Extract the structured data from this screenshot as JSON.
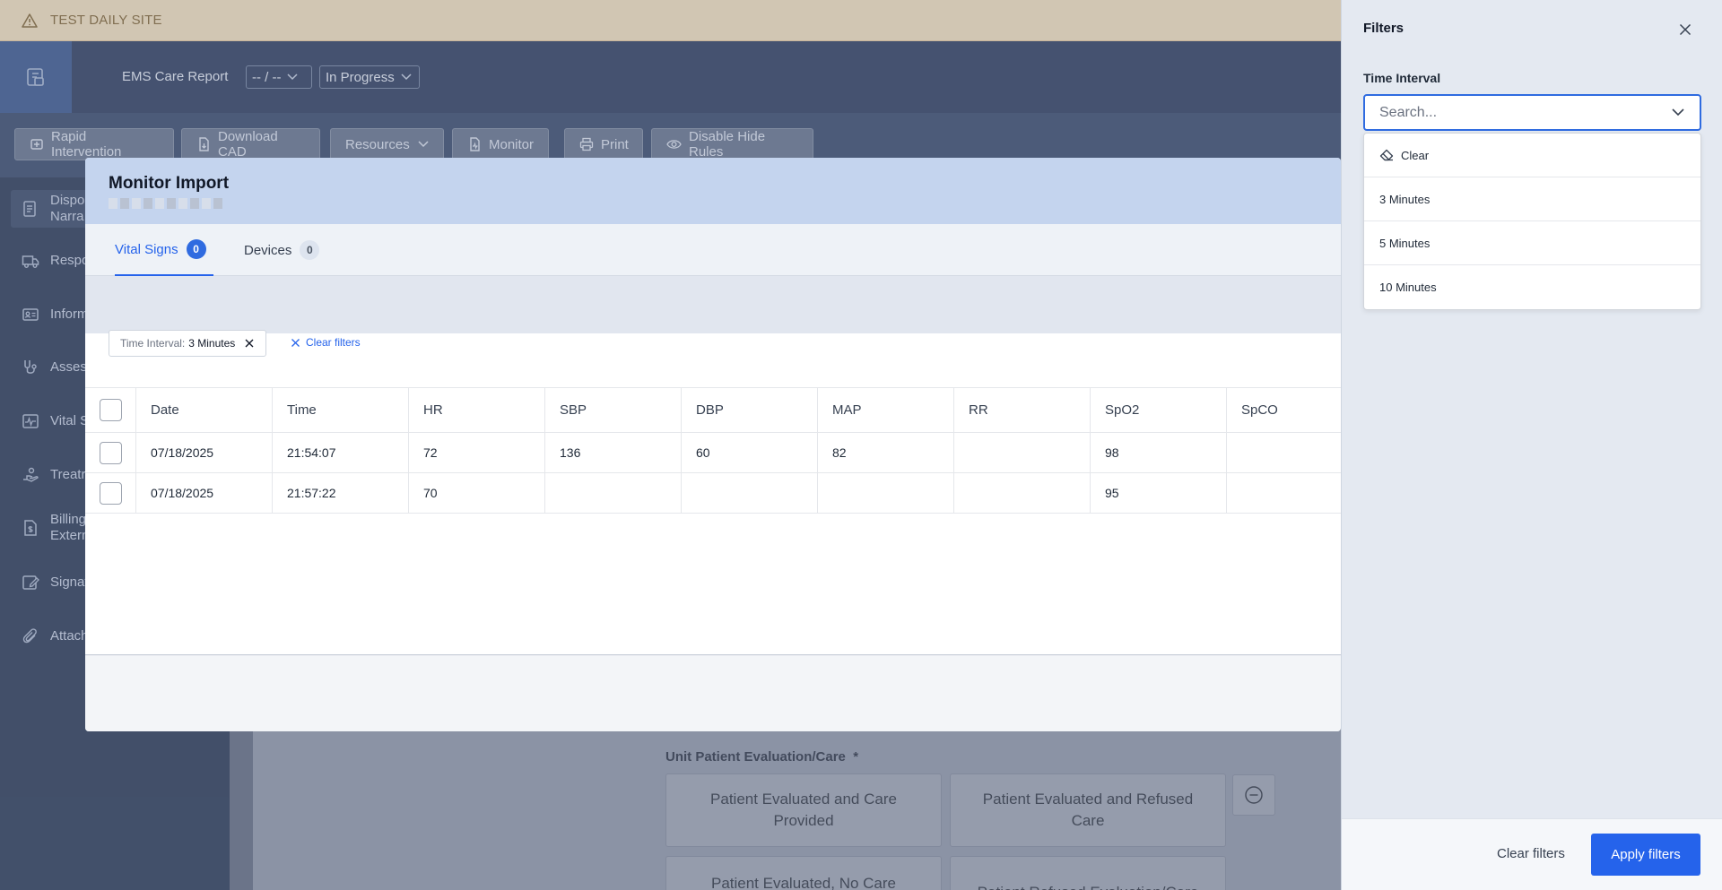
{
  "banner": {
    "text": "TEST DAILY SITE"
  },
  "header": {
    "title": "EMS Care Report",
    "date_select": "-- / --",
    "status_select": "In Progress"
  },
  "toolbar": {
    "buttons": [
      "Rapid Intervention",
      "Download CAD",
      "Resources",
      "Monitor",
      "Print",
      "Disable Hide Rules"
    ]
  },
  "sidebar": {
    "items": [
      {
        "line1": "Dispo",
        "line2": "Narra",
        "icon": "document-icon"
      },
      {
        "line1": "Respo",
        "line2": "",
        "icon": "truck-icon"
      },
      {
        "line1": "Inform",
        "line2": "",
        "icon": "id-card-icon"
      },
      {
        "line1": "Asses",
        "line2": "",
        "icon": "stethoscope-icon"
      },
      {
        "line1": "Vital S",
        "line2": "",
        "icon": "vitals-icon"
      },
      {
        "line1": "Treatr",
        "line2": "",
        "icon": "hand-care-icon"
      },
      {
        "line1": "Billing",
        "line2": "Extern",
        "icon": "billing-icon"
      },
      {
        "line1": "Signat",
        "line2": "",
        "icon": "signature-icon"
      },
      {
        "line1": "Attach",
        "line2": "",
        "icon": "paperclip-icon"
      }
    ]
  },
  "evaluation": {
    "label": "Unit Patient Evaluation/Care",
    "required": "*",
    "options": [
      "Patient Evaluated and Care Provided",
      "Patient Evaluated and Refused Care",
      "Patient Evaluated, No Care",
      "Patient Refused Evaluation/Care"
    ]
  },
  "modal": {
    "title": "Monitor Import",
    "tabs": [
      {
        "label": "Vital Signs",
        "count": "0"
      },
      {
        "label": "Devices",
        "count": "0"
      }
    ],
    "chip": {
      "key": "Time Interval:",
      "value": "3 Minutes"
    },
    "clear_filters": "Clear filters",
    "columns": [
      "Date",
      "Time",
      "HR",
      "SBP",
      "DBP",
      "MAP",
      "RR",
      "SpO2",
      "SpCO"
    ],
    "rows": [
      [
        "07/18/2025",
        "21:54:07",
        "72",
        "136",
        "60",
        "82",
        "",
        "98",
        ""
      ],
      [
        "07/18/2025",
        "21:57:22",
        "70",
        "",
        "",
        "",
        "",
        "95",
        ""
      ]
    ]
  },
  "filters": {
    "title": "Filters",
    "field_label": "Time Interval",
    "search_placeholder": "Search...",
    "options": [
      "Clear",
      "3 Minutes",
      "5 Minutes",
      "10 Minutes"
    ],
    "clear_label": "Clear filters",
    "apply_label": "Apply filters"
  },
  "colors": {
    "accent": "#2563eb",
    "banner": "#f6e0b8",
    "header": "#1f2f52"
  }
}
